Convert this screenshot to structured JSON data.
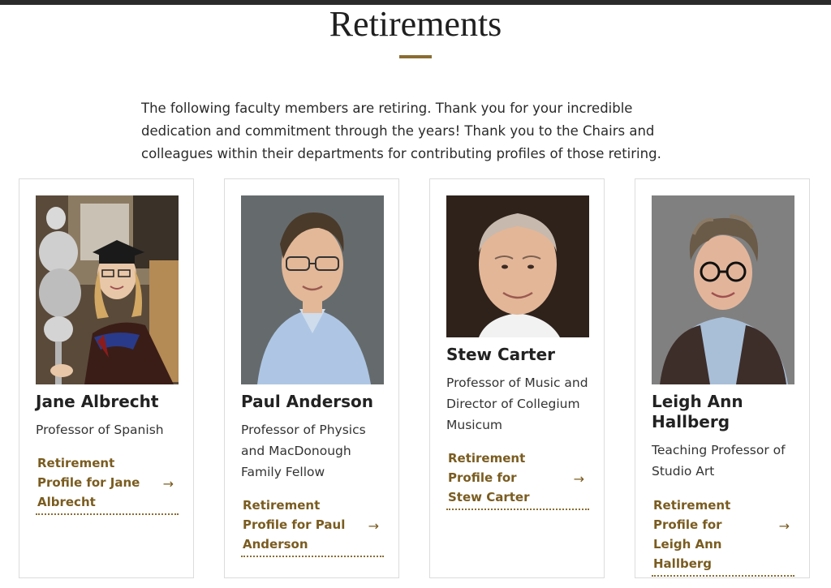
{
  "page": {
    "title": "Retirements",
    "intro": "The following faculty members are retiring. Thank you for your incredible dedication and commitment through the years! Thank you to the Chairs and colleagues within their departments for contributing profiles of those retiring."
  },
  "colors": {
    "accent": "#8a6d32",
    "link": "#7a5c20",
    "topbar": "#2b2b2b"
  },
  "icons": {
    "link_arrow": "right-arrow-icon"
  },
  "arrow_glyph": "→",
  "faculty": [
    {
      "name": "Jane Albrecht",
      "role": "Professor of Spanish",
      "link_label": "Retirement Profile for Jane Albrecht"
    },
    {
      "name": "Paul Anderson",
      "role": "Professor of Physics and MacDonough Family Fellow",
      "link_label": "Retirement Profile for Paul Anderson"
    },
    {
      "name": "Stew Carter",
      "role": "Professor of Music and Director of Collegium Musicum",
      "link_label": "Retirement Profile for Stew Carter"
    },
    {
      "name": "Leigh Ann Hallberg",
      "role": "Teaching Professor of Studio Art",
      "link_label": "Retirement Profile for Leigh Ann Hallberg"
    }
  ]
}
